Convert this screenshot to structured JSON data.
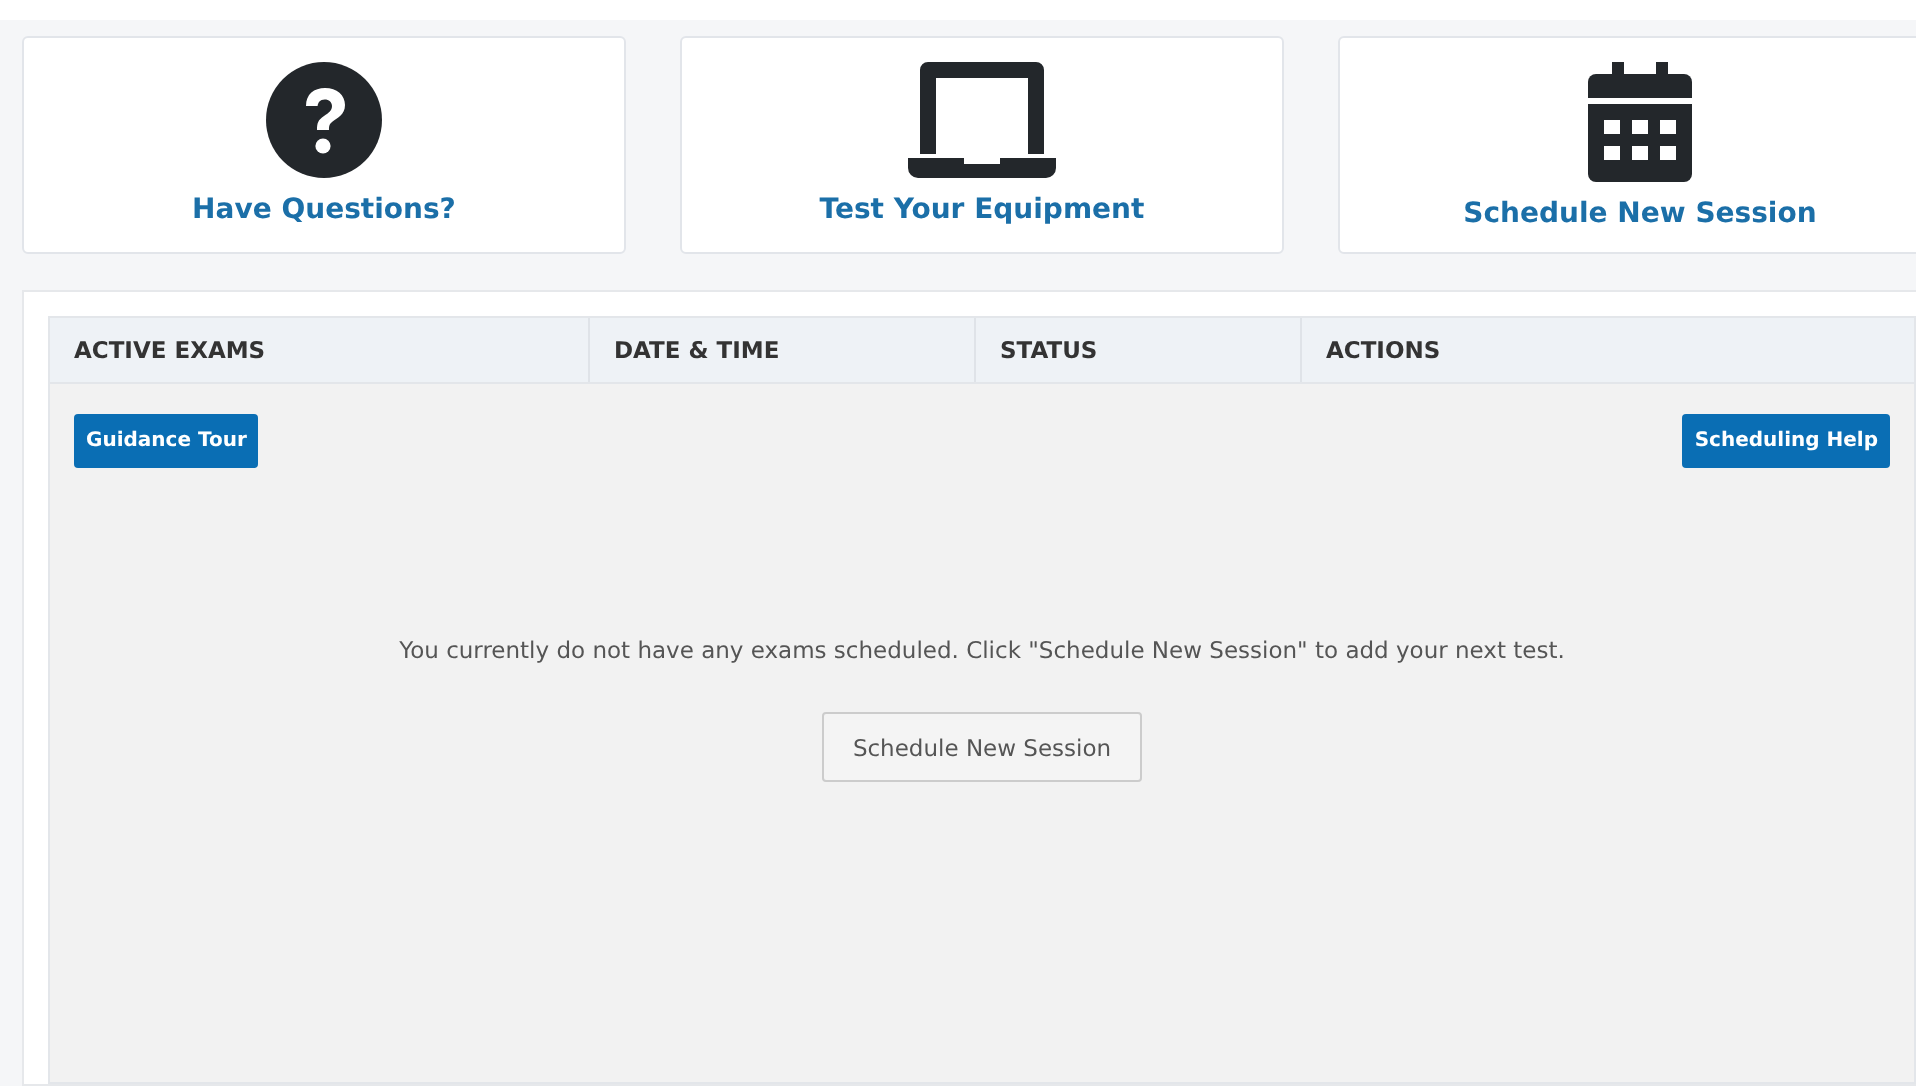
{
  "cards": [
    {
      "kind": "question",
      "label": "Have Questions?"
    },
    {
      "kind": "laptop",
      "label": "Test Your Equipment"
    },
    {
      "kind": "calendar",
      "label": "Schedule New Session"
    }
  ],
  "table": {
    "columns": [
      "ACTIVE EXAMS",
      "DATE & TIME",
      "STATUS",
      "ACTIONS"
    ],
    "left_button": "Guidance Tour",
    "right_button": "Scheduling Help",
    "empty_message": "You currently do not have any exams scheduled. Click \"Schedule New Session\" to add your next test.",
    "empty_button": "Schedule New Session"
  }
}
